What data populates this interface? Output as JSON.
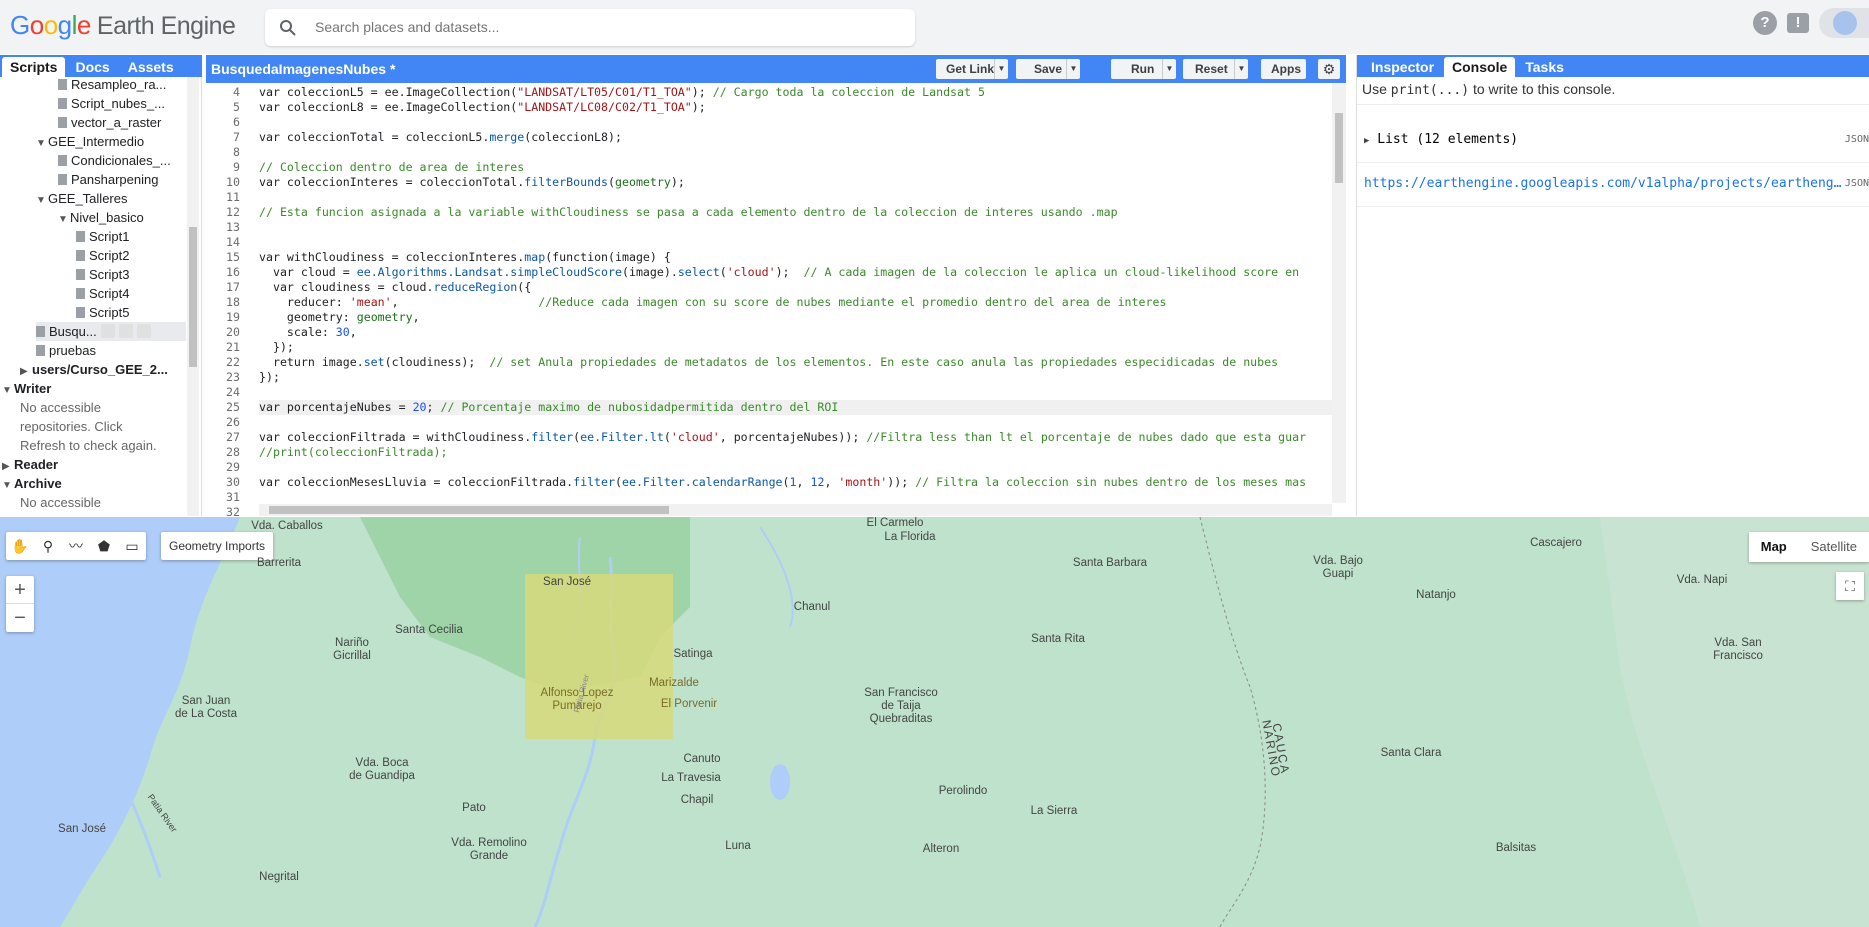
{
  "header": {
    "logo_google": [
      "G",
      "o",
      "o",
      "g",
      "l",
      "e"
    ],
    "logo_product": "Earth Engine",
    "search_placeholder": "Search places and datasets...",
    "icons": [
      "help-icon",
      "feedback-icon",
      "account-icon"
    ]
  },
  "left_panel": {
    "tabs": [
      "Scripts",
      "Docs",
      "Assets"
    ],
    "active_tab": "Scripts",
    "tree": [
      {
        "label": "Resampleo_ra...",
        "type": "file",
        "depth": 2
      },
      {
        "label": "Script_nubes_...",
        "type": "file",
        "depth": 2
      },
      {
        "label": "vector_a_raster",
        "type": "file",
        "depth": 2
      },
      {
        "label": "GEE_Intermedio",
        "type": "folder",
        "depth": 1
      },
      {
        "label": "Condicionales_...",
        "type": "file",
        "depth": 2
      },
      {
        "label": "Pansharpening",
        "type": "file",
        "depth": 2
      },
      {
        "label": "GEE_Talleres",
        "type": "folder",
        "depth": 1
      },
      {
        "label": "Nivel_basico",
        "type": "folder",
        "depth": 2
      },
      {
        "label": "Script1",
        "type": "file",
        "depth": 3
      },
      {
        "label": "Script2",
        "type": "file",
        "depth": 3
      },
      {
        "label": "Script3",
        "type": "file",
        "depth": 3
      },
      {
        "label": "Script4",
        "type": "file",
        "depth": 3
      },
      {
        "label": "Script5",
        "type": "file",
        "depth": 3
      },
      {
        "label": "Busqu...",
        "type": "file-selected",
        "depth": 1
      },
      {
        "label": "pruebas",
        "type": "file",
        "depth": 1
      },
      {
        "label": "users/Curso_GEE_2...",
        "type": "repo",
        "depth": 0
      },
      {
        "label": "Writer",
        "type": "section",
        "depth": -1
      },
      {
        "label": "No accessible",
        "type": "note",
        "depth": 0
      },
      {
        "label": "repositories. Click",
        "type": "note",
        "depth": 0
      },
      {
        "label": "Refresh to check again.",
        "type": "note",
        "depth": 0
      },
      {
        "label": "Reader",
        "type": "section-collapsed",
        "depth": -1
      },
      {
        "label": "Archive",
        "type": "section",
        "depth": -1
      },
      {
        "label": "No accessible",
        "type": "note",
        "depth": 0
      }
    ]
  },
  "editor": {
    "title": "BusquedaImagenesNubes *",
    "buttons": {
      "get_link": "Get Link",
      "save": "Save",
      "run": "Run",
      "reset": "Reset",
      "apps": "Apps"
    },
    "lines": [
      {
        "n": "4",
        "html": "var coleccionL5 = ee.ImageCollection(<s>\"LANDSAT/LT05/C01/T1_TOA\"</s>); <c>// Cargo toda la coleccion de Landsat 5</c>"
      },
      {
        "n": "5",
        "html": "var coleccionL8 = ee.ImageCollection(<s>\"LANDSAT/LC08/C02/T1_TOA\"</s>);"
      },
      {
        "n": "6",
        "html": ""
      },
      {
        "n": "7",
        "html": "var coleccionTotal = coleccionL5.<f>merge</f>(coleccionL8);"
      },
      {
        "n": "8",
        "html": ""
      },
      {
        "n": "9",
        "html": "<c>// Coleccion dentro de area de interes</c>"
      },
      {
        "n": "10",
        "html": "var coleccionInteres = coleccionTotal.<f>filterBounds</f>(<p>geometry</p>);"
      },
      {
        "n": "11",
        "html": ""
      },
      {
        "n": "12",
        "html": "<c>// Esta funcion asignada a la variable withCloudiness se pasa a cada elemento dentro de la coleccion de interes usando .map</c>"
      },
      {
        "n": "13",
        "html": ""
      },
      {
        "n": "14",
        "html": ""
      },
      {
        "n": "15",
        "html": "var withCloudiness = coleccionInteres.<f>map</f>(function(image) {"
      },
      {
        "n": "16",
        "html": "  var cloud = <f>ee.Algorithms.Landsat.simpleCloudScore</f>(image).<f>select</f>(<s>'cloud'</s>);  <c>// A cada imagen de la coleccion le aplica un cloud-likelihood score en</c>"
      },
      {
        "n": "17",
        "html": "  var cloudiness = cloud.<f>reduceRegion</f>({"
      },
      {
        "n": "18",
        "html": "    reducer: <s>'mean'</s>,                    <c>//Reduce cada imagen con su score de nubes mediante el promedio dentro del area de interes</c>"
      },
      {
        "n": "19",
        "html": "    geometry: <p>geometry</p>,"
      },
      {
        "n": "20",
        "html": "    scale: <n>30</n>,"
      },
      {
        "n": "21",
        "html": "  });"
      },
      {
        "n": "22",
        "html": "  return image.<f>set</f>(cloudiness);  <c>// set Anula propiedades de metadatos de los elementos. En este caso anula las propiedades especidicadas de nubes</c>"
      },
      {
        "n": "23",
        "html": "});"
      },
      {
        "n": "24",
        "html": ""
      },
      {
        "n": "25",
        "html": "var porcentajeNubes = <n>20</n>; <c>// Porcentaje maximo de nubosidadpermitida dentro del ROI</c>"
      },
      {
        "n": "26",
        "html": ""
      },
      {
        "n": "27",
        "html": "var coleccionFiltrada = withCloudiness.<f>filter</f>(<f>ee.Filter.lt</f>(<s>'cloud'</s>, porcentajeNubes)); <c>//Filtra less than lt el porcentaje de nubes dado que esta guar</c>"
      },
      {
        "n": "28",
        "html": "<c>//print(coleccionFiltrada);</c>"
      },
      {
        "n": "29",
        "html": ""
      },
      {
        "n": "30",
        "html": "var coleccionMesesLluvia = coleccionFiltrada.<f>filter</f>(<f>ee.Filter.calendarRange</f>(<n>1</n>, <n>12</n>, <s>'month'</s>)); <c>// Filtra la coleccion sin nubes dentro de los meses mas</c>"
      },
      {
        "n": "31",
        "html": ""
      },
      {
        "n": "32",
        "html": ""
      }
    ]
  },
  "right_panel": {
    "tabs": [
      "Inspector",
      "Console",
      "Tasks"
    ],
    "active_tab": "Console",
    "hint_pre": "Use ",
    "hint_code": "print(...)",
    "hint_post": " to write to this console.",
    "entries": [
      {
        "text": "List (12 elements)",
        "tag": "JSON"
      },
      {
        "text": "https://earthengine.googleapis.com/v1alpha/projects/eartheng…",
        "tag": "JSON"
      }
    ]
  },
  "map": {
    "geometry_imports": "Geometry Imports",
    "map_types": [
      "Map",
      "Satellite"
    ],
    "active_map_type": "Map",
    "zoom_in": "+",
    "zoom_out": "−",
    "places": [
      "Vda. Caballos",
      "El Carmelo",
      "La Florida",
      "Barrerita",
      "San José",
      "Santa Barbara",
      "Vda. Bajo\nGuapi",
      "Cascajero",
      "Natanjo",
      "Vda. Napi",
      "Chanul",
      "Nariño\nGicrillal",
      "Santa Cecilia",
      "Santa Rita",
      "Satinga",
      "Vda. San\nFrancisco",
      "Alfonso Lopez\nPumarejo",
      "Marizalde",
      "El Porvenir",
      "San Francisco\nde Taija\nQuebraditas",
      "San Juan\nde La Costa",
      "Canuto",
      "Vda. Boca\nde Guandipa",
      "La Travesia",
      "Santa Clara",
      "Chapil",
      "Perolindo",
      "Pato",
      "La Sierra",
      "San José",
      "Vda. Remolino\nGrande",
      "Luna",
      "Alteron",
      "Balsitas",
      "Negrital"
    ],
    "departments": [
      "NARIÑO",
      "CAUCA"
    ],
    "rivers": [
      "Patia River",
      "Patia River"
    ]
  }
}
